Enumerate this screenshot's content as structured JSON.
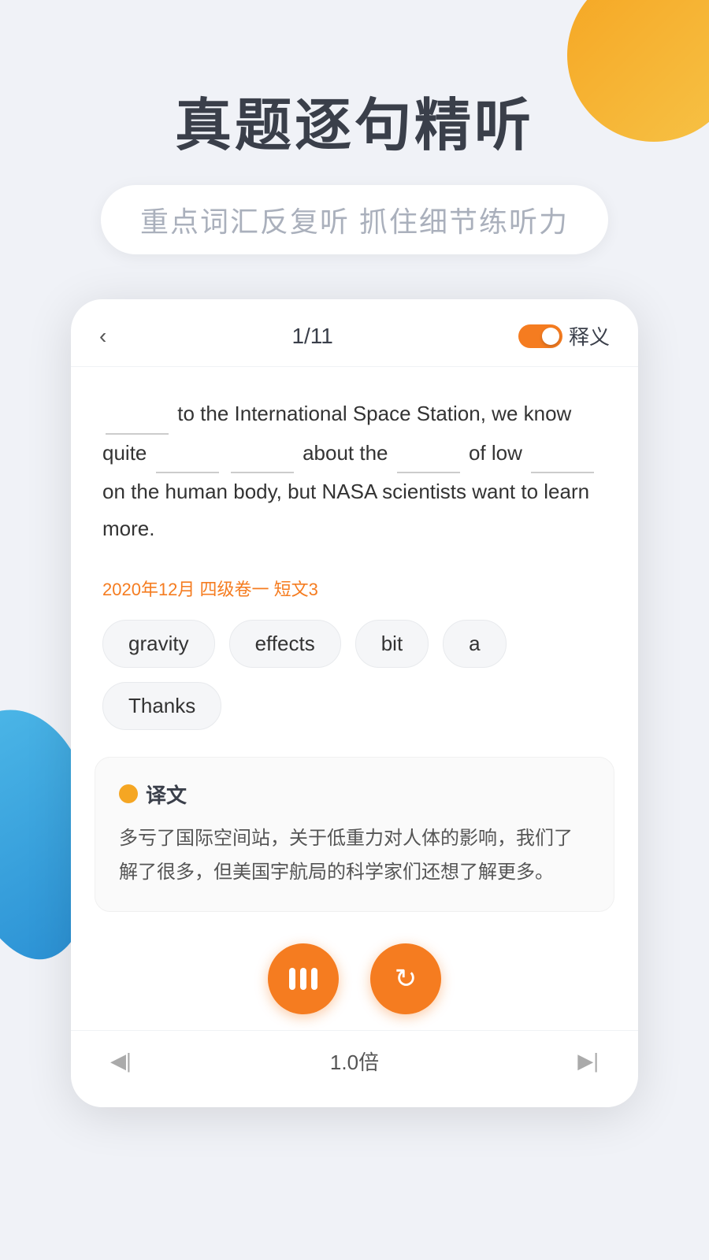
{
  "background": {
    "color": "#f0f2f7"
  },
  "header": {
    "main_title": "真题逐句精听",
    "subtitle": "重点词汇反复听  抓住细节练听力"
  },
  "card": {
    "nav": {
      "back_label": "‹",
      "progress": "1/11",
      "toggle_label": "释义",
      "toggle_state": true
    },
    "sentence": "_______ to the International Space Station, we know quite _______ _______ about the _______ of low _______ on the human body, but NASA scientists want to learn more.",
    "source": "2020年12月 四级卷一 短文3",
    "word_chips": [
      {
        "id": "gravity",
        "text": "gravity"
      },
      {
        "id": "effects",
        "text": "effects"
      },
      {
        "id": "bit",
        "text": "bit"
      },
      {
        "id": "a",
        "text": "a"
      },
      {
        "id": "thanks",
        "text": "Thanks"
      }
    ],
    "translation": {
      "label": "译文",
      "text": "多亏了国际空间站，关于低重力对人体的影响，我们了解了很多，但美国宇航局的科学家们还想了解更多。"
    },
    "controls": {
      "pause_label": "pause",
      "refresh_label": "refresh"
    },
    "bottom_bar": {
      "skip_prev": "◀|",
      "speed": "1.0倍",
      "skip_next": "▶|"
    }
  }
}
